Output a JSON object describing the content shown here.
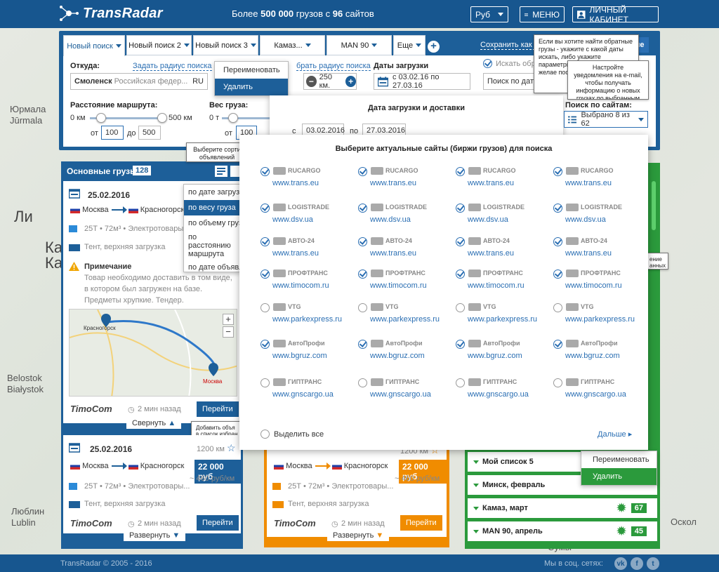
{
  "header": {
    "logo": "TransRadar",
    "tagline_pre": "Более ",
    "tagline_bold1": "500 000",
    "tagline_mid": " грузов с ",
    "tagline_bold2": "96",
    "tagline_post": " сайтов",
    "currency": "Руб",
    "menu_label": "МЕНЮ",
    "cabinet_label": "ЛИЧНЫЙ КАБИНЕТ"
  },
  "tabs": [
    {
      "label": "Новый поиск"
    },
    {
      "label": "Новый поиск 2"
    },
    {
      "label": "Новый поиск 3"
    },
    {
      "label": "Камаз..."
    },
    {
      "label": "MAN 90"
    },
    {
      "label": "Еще"
    }
  ],
  "save_link": "Сохранить как и",
  "save_btn_tail": "ние",
  "tooltip_return": "Если вы хотите найти обратные грузы - укажите с какой даты искать, либо укажите параметры для авто (максим и желае после д основн",
  "tooltip_notify": "Настройте уведомления на e-mail, чтобы получать информацию о новых грузах по выбранным параметрам поиска",
  "tab_menu": {
    "rename": "Переименовать",
    "delete": "Удалить"
  },
  "from": {
    "label": "Откуда:",
    "radius_link": "Задать радиус поиска",
    "city": "Смоленск",
    "region": "Российская федер...",
    "country": "RU"
  },
  "to": {
    "radius_link": "брать радиус поиска",
    "radius": "250 км."
  },
  "dates": {
    "label": "Даты загрузки",
    "range": "с 03.02.16 по 27.03.16",
    "panel_title": "Дата загрузки и доставки",
    "from_prefix": "с",
    "from": "03.02.2016",
    "to_prefix": "по",
    "to": "27.03.2016"
  },
  "return_search": {
    "label": "Искать обр",
    "placeholder": "Поиск по дате"
  },
  "distance": {
    "label": "Расстояние маршрута:",
    "min": "0 км",
    "max": "500 км",
    "from_lbl": "от",
    "from": "100",
    "to_lbl": "до",
    "to": "500"
  },
  "weight": {
    "label": "Вес груза:",
    "min": "0 т",
    "from_lbl": "от",
    "from": "100"
  },
  "site_search": {
    "label": "Поиск по сайтам:",
    "value": "Выбрано 8 из 62"
  },
  "sort_tooltip": "Выберите сорти объявлений",
  "sort_menu": [
    "по дате загрузк",
    "по весу груза",
    "по объему груза",
    "по расстоянию маршрута",
    "по дате объявл"
  ],
  "main_column": {
    "title": "Основные грузы",
    "count": "128"
  },
  "card1": {
    "date": "25.02.2016",
    "from": "Москва",
    "to": "Красногорск",
    "specs": "25Т • 72м³ • Электротовары",
    "truck": "Тент, верхняя загрузка",
    "note_title": "Примечание",
    "note_text": "Товар необходимо доставить в том виде, в котором был загружен на базе. Предметы хрупкие. Тендер.",
    "map_from": "Красногорск",
    "map_to": "Москва",
    "brand": "TimoCom",
    "time": "2 мин назад",
    "go": "Перейти",
    "collapse": "Свернуть"
  },
  "fav_tooltip": "Добавить объя в список избран",
  "card2": {
    "date": "25.02.2016",
    "km": "1200 км",
    "from": "Москва",
    "to": "Красногорск",
    "price": "22 000 руб",
    "per": "~ 460 руб/км",
    "specs": "25Т • 72м³ • Электротовары...",
    "truck": "Тент, верхняя загрузка",
    "brand": "TimoCom",
    "time": "2 мин назад",
    "go": "Перейти",
    "expand": "Развернуть"
  },
  "card3": {
    "km": "1200 км",
    "from": "Москва",
    "to": "Красногорск",
    "price": "22 000 руб",
    "per": "~ 460 руб/км",
    "specs": "25Т • 72м³ • Электротовары...",
    "truck": "Тент, верхняя загрузка",
    "brand": "TimoCom",
    "time": "2 мин назад",
    "go": "Перейти",
    "expand": "Развернуть"
  },
  "sites_panel": {
    "title": "Выберите актуальные сайты (биржи грузов) для поиска",
    "select_all": "Выделить все",
    "next": "Дальше",
    "rows": [
      {
        "logo": "RUCARGO",
        "url": "www.trans.eu",
        "checked": true
      },
      {
        "logo": "LOGISTRADE",
        "url": "www.dsv.ua",
        "checked": true
      },
      {
        "logo": "АВТО-24",
        "url": "www.trans.eu",
        "checked": true
      },
      {
        "logo": "ПРОФТРАНС",
        "url": "www.timocom.ru",
        "checked": true
      },
      {
        "logo": "VTG",
        "url": "www.parkexpress.ru",
        "checked": false
      },
      {
        "logo": "АвтоПрофи",
        "url": "www.bgruz.com",
        "checked": true
      },
      {
        "logo": "ГИПТРАНС",
        "url": "www.gnscargo.ua",
        "checked": false
      }
    ]
  },
  "green_lists": [
    {
      "label": "Мой список 5",
      "count": ""
    },
    {
      "label": "Минск, февраль",
      "count": ""
    },
    {
      "label": "Камаз, март",
      "count": "67"
    },
    {
      "label": "MAN 90, апрель",
      "count": "45"
    }
  ],
  "green_menu": {
    "rename": "Переименовать",
    "delete": "Удалить"
  },
  "side_tooltip": "ение анных",
  "map_labels": [
    "Юрмала",
    "Jūrmala",
    "Ли",
    "Ка",
    "Ка",
    "Belostok",
    "Białystok",
    "Люблин",
    "Lublin",
    "Оскол",
    "Сумы"
  ],
  "footer": {
    "copyright": "TransRadar © 2005 - 2016",
    "social": "Мы в соц. сетях:"
  },
  "colors": {
    "primary": "#1d5f99",
    "orange": "#f08c00",
    "green": "#2b9a3c"
  }
}
